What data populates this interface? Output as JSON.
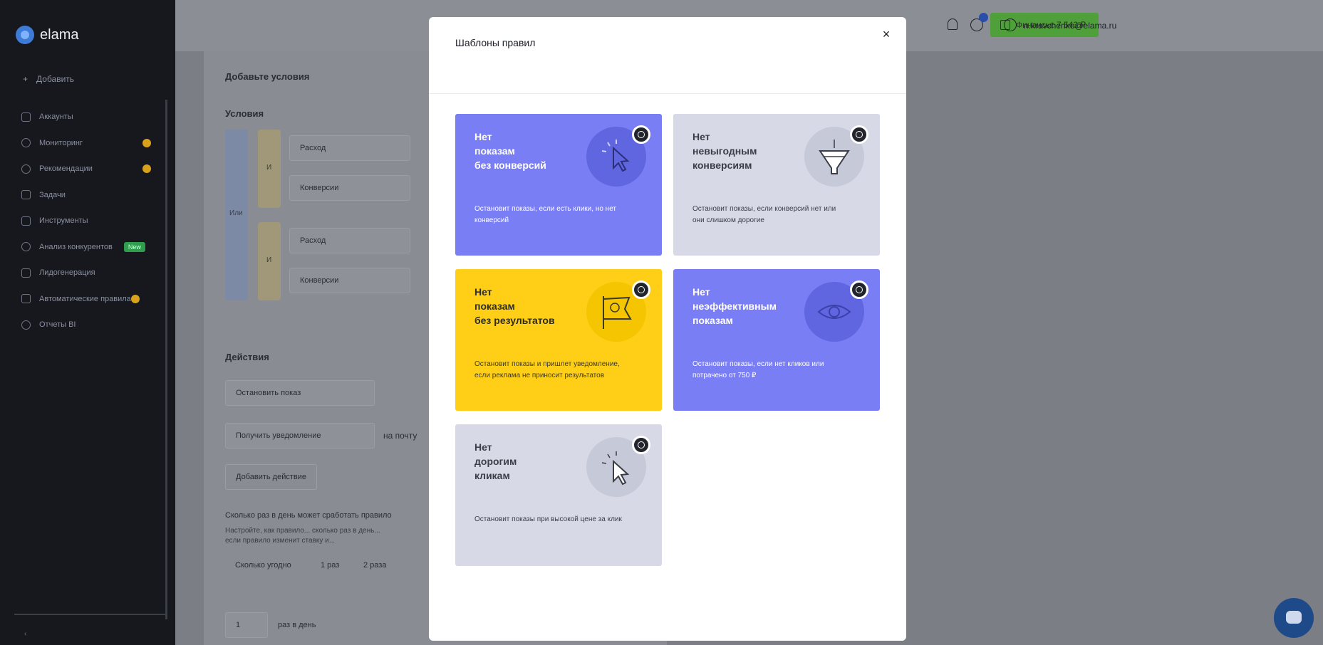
{
  "app": {
    "brand": "elama"
  },
  "sidebar": {
    "add_label": "Добавить",
    "items": [
      {
        "label": "Аккаунты"
      },
      {
        "label": "Мониторинг"
      },
      {
        "label": "Рекомендации"
      },
      {
        "label": "Задачи"
      },
      {
        "label": "Инструменты"
      },
      {
        "label": "Анализ конкурентов",
        "badge": "New"
      },
      {
        "label": "Лидогенерация"
      },
      {
        "label": "Автоматические правила"
      },
      {
        "label": "Отчеты BI"
      }
    ]
  },
  "topbar": {
    "finance_label": "Финансы: 7 543 ₽",
    "user_email": "n.kravchenko@elama.ru"
  },
  "background": {
    "add_conditions": "Добавьте условия",
    "conditions": "Условия",
    "or_label": "Или",
    "and_label": "И",
    "field_spend": "Расход",
    "field_conversions": "Конверсии",
    "actions": "Действия",
    "action_stop": "Остановить показ",
    "action_notify": "Получить уведомление",
    "action_notify_suffix": "на почту",
    "add_action": "Добавить действие",
    "freq_title": "Сколько раз в день может сработать правило",
    "freq_desc_1": "Настройте, как правило... сколько раз в день...",
    "freq_desc_2": "если правило изменит ставку и...",
    "freq_opt_1": "Сколько угодно",
    "freq_opt_2": "1 раз",
    "freq_opt_3": "2 раза",
    "footer_num": "1",
    "footer_text": "раз в день"
  },
  "modal": {
    "title": "Шаблоны правил",
    "close": "×",
    "cards": [
      {
        "title": "Нет\nпоказам\nбез конверсий",
        "desc": "Остановит показы, если есть клики, но нет конверсий",
        "icon": "cursor-click-icon",
        "theme": "blue"
      },
      {
        "title": "Нет\nневыгодным\nконверсиям",
        "desc": "Остановит показы, если конверсий нет или они слишком дорогие",
        "icon": "funnel-icon",
        "theme": "gray"
      },
      {
        "title": "Нет\nпоказам\nбез результатов",
        "desc": "Остановит показы и пришлет уведомление, если реклама не приносит результатов",
        "icon": "flag-icon",
        "theme": "yellow"
      },
      {
        "title": "Нет\nнеэффективным\nпоказам",
        "desc": "Остановит показы, если нет кликов или потрачено от 750 ₽",
        "icon": "eye-icon",
        "theme": "blue"
      },
      {
        "title": "Нет\nдорогим\nкликам",
        "desc": "Остановит показы при высокой цене за клик",
        "icon": "cursor-click-icon",
        "theme": "gray"
      }
    ]
  },
  "colors": {
    "blue_card": "#7a7ef5",
    "gray_card": "#d7dae6",
    "yellow_card": "#fecf16",
    "sidebar_bg": "#16181d",
    "overlay": "#7b7e85"
  }
}
